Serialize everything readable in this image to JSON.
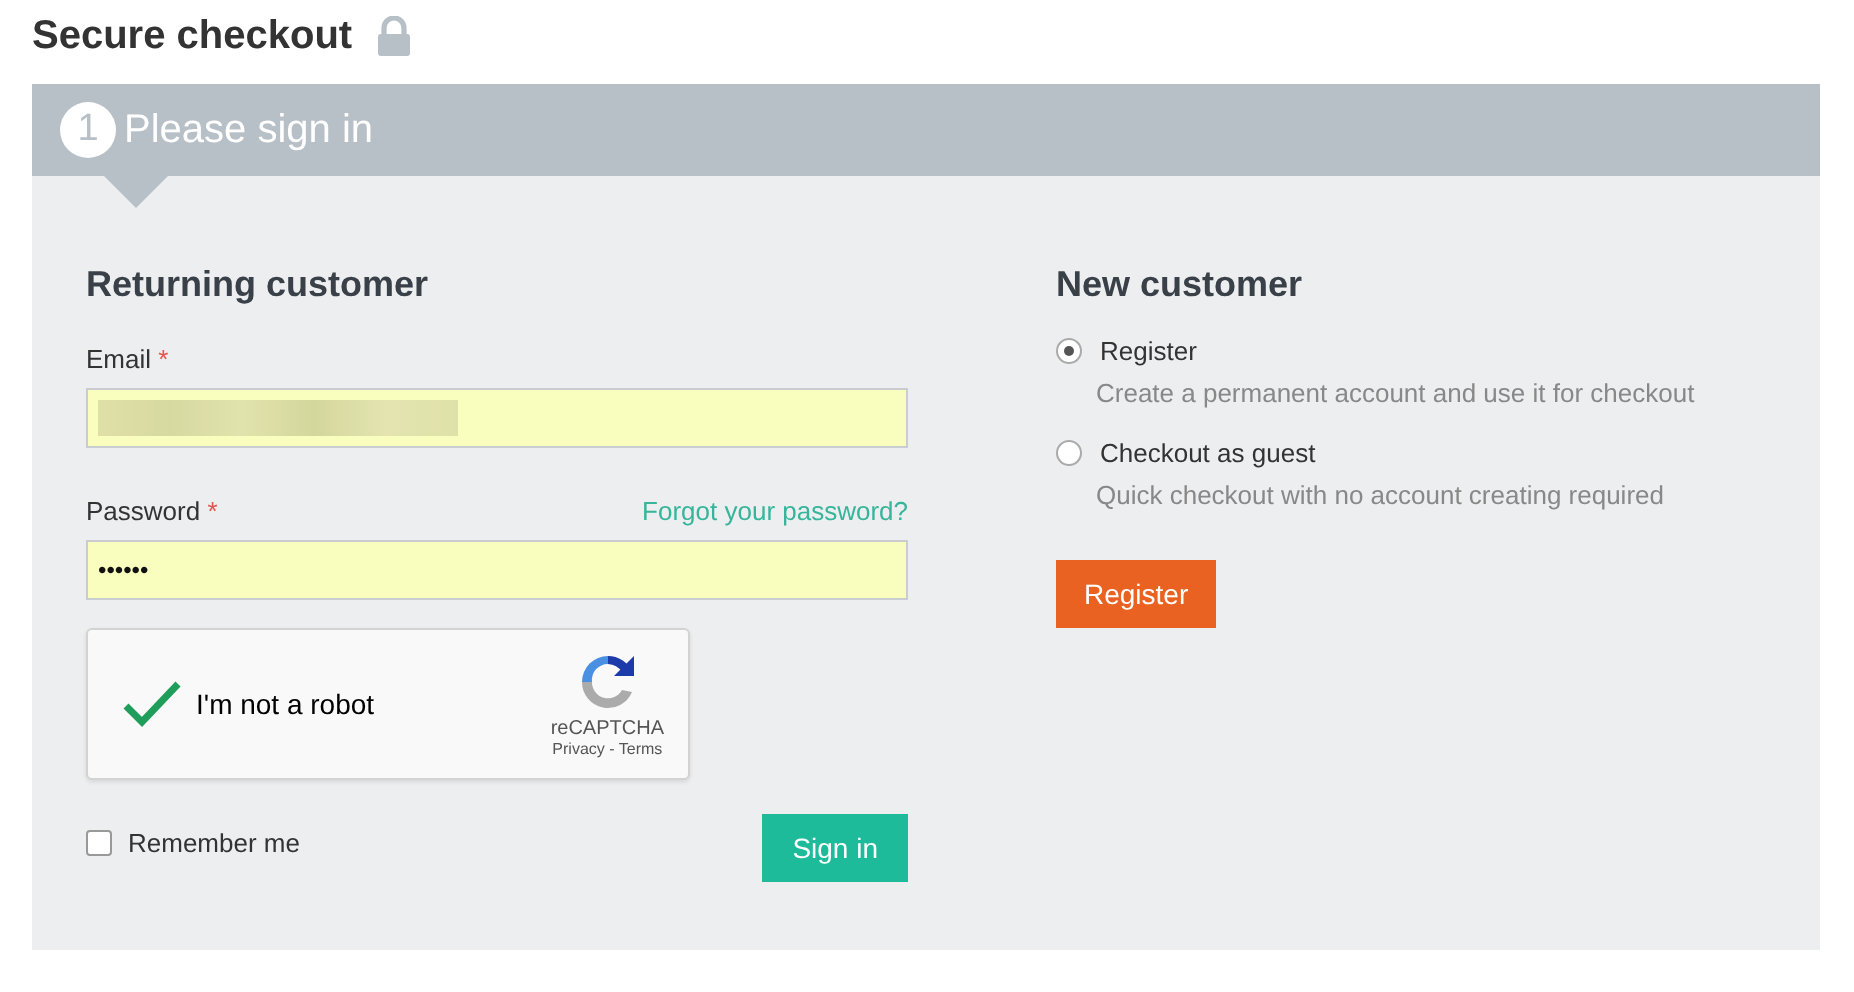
{
  "page_title": "Secure checkout",
  "step": {
    "number": "1",
    "title": "Please sign in"
  },
  "returning_customer": {
    "heading": "Returning customer",
    "email": {
      "label": "Email",
      "required_mark": "*",
      "value_redacted": true
    },
    "password": {
      "label": "Password",
      "required_mark": "*",
      "value": "••••••",
      "forgot_link": "Forgot your password?"
    },
    "captcha": {
      "checked": true,
      "label": "I'm not a robot",
      "brand": "reCAPTCHA",
      "links": "Privacy - Terms"
    },
    "remember_me": {
      "label": "Remember me",
      "checked": false
    },
    "button": "Sign in"
  },
  "new_customer": {
    "heading": "New customer",
    "options": [
      {
        "label": "Register",
        "description": "Create a permanent account and use it for checkout",
        "selected": true
      },
      {
        "label": "Checkout as guest",
        "description": "Quick checkout with no account creating required",
        "selected": false
      }
    ],
    "button": "Register"
  }
}
